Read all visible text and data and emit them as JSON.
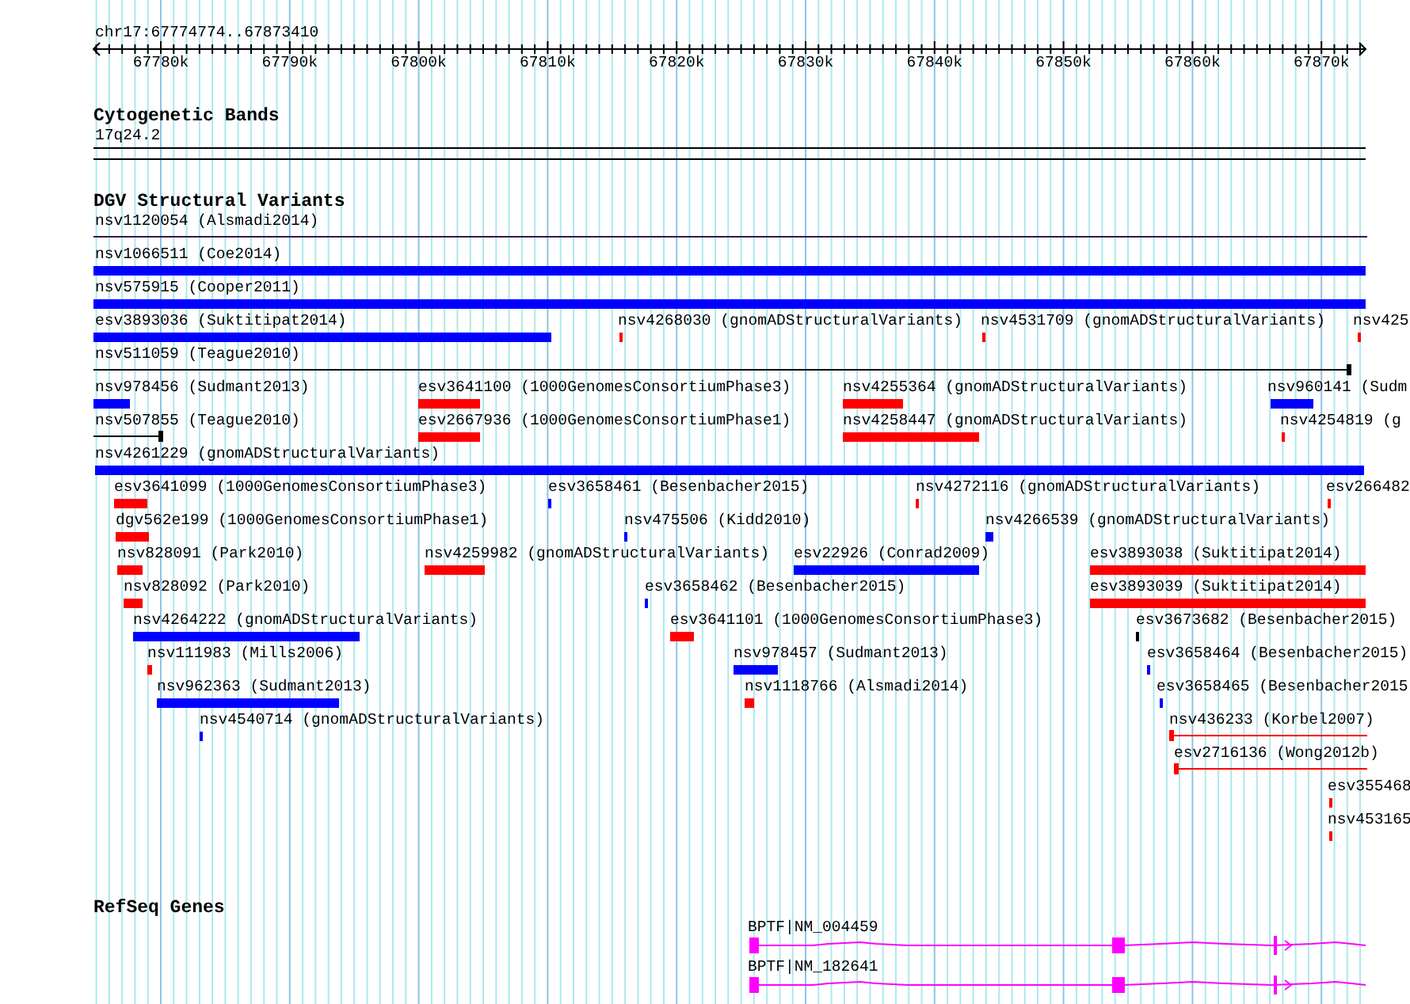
{
  "ruler": {
    "position": "chr17:67774774..67873410",
    "ticks": [
      "67780k",
      "67790k",
      "67800k",
      "67810k",
      "67820k",
      "67830k",
      "67840k",
      "67850k",
      "67860k",
      "67870k"
    ]
  },
  "cytogenetic_bands": {
    "title": "Cytogenetic Bands",
    "band": "17q24.2"
  },
  "dgv_structural_variants": {
    "title": "DGV Structural Variants",
    "variants": [
      {
        "label": "nsv1120054 (Alsmadi2014)",
        "kind": "line",
        "color": "#3c1450"
      },
      {
        "label": "nsv1066511 (Coe2014)",
        "kind": "bar",
        "color": "#0000ff"
      },
      {
        "label": "nsv575915 (Cooper2011)",
        "kind": "bar",
        "color": "#0000ff"
      },
      {
        "label": "esv3893036 (Suktitipat2014)",
        "kind": "bar",
        "color": "#0000ff"
      },
      {
        "label": "nsv4268030 (gnomADStructuralVariants)",
        "kind": "bar",
        "color": "#ff0000"
      },
      {
        "label": "nsv4531709 (gnomADStructuralVariants)",
        "kind": "bar",
        "color": "#ff0000"
      },
      {
        "label": "nsv425",
        "kind": "bar",
        "color": "#ff0000"
      },
      {
        "label": "nsv511059 (Teague2010)",
        "kind": "line",
        "color": "#000000"
      },
      {
        "label": "nsv978456 (Sudmant2013)",
        "kind": "bar",
        "color": "#0000ff"
      },
      {
        "label": "esv3641100 (1000GenomesConsortiumPhase3)",
        "kind": "bar",
        "color": "#ff0000"
      },
      {
        "label": "nsv4255364 (gnomADStructuralVariants)",
        "kind": "bar",
        "color": "#ff0000"
      },
      {
        "label": "nsv960141 (Sudm",
        "kind": "bar",
        "color": "#0000ff"
      },
      {
        "label": "nsv507855 (Teague2010)",
        "kind": "line",
        "color": "#000000"
      },
      {
        "label": "esv2667936 (1000GenomesConsortiumPhase1)",
        "kind": "bar",
        "color": "#ff0000"
      },
      {
        "label": "nsv4258447 (gnomADStructuralVariants)",
        "kind": "bar",
        "color": "#ff0000"
      },
      {
        "label": "nsv4254819 (g",
        "kind": "bar",
        "color": "#ff0000"
      },
      {
        "label": "nsv4261229 (gnomADStructuralVariants)",
        "kind": "bar",
        "color": "#0000ff"
      },
      {
        "label": "esv3641099 (1000GenomesConsortiumPhase3)",
        "kind": "bar",
        "color": "#ff0000"
      },
      {
        "label": "esv3658461 (Besenbacher2015)",
        "kind": "bar",
        "color": "#0000ff"
      },
      {
        "label": "nsv4272116 (gnomADStructuralVariants)",
        "kind": "bar",
        "color": "#ff0000"
      },
      {
        "label": "esv266482",
        "kind": "bar",
        "color": "#ff0000"
      },
      {
        "label": "dgv562e199 (1000GenomesConsortiumPhase1)",
        "kind": "bar",
        "color": "#ff0000"
      },
      {
        "label": "nsv475506 (Kidd2010)",
        "kind": "bar",
        "color": "#0000ff"
      },
      {
        "label": "nsv4266539 (gnomADStructuralVariants)",
        "kind": "bar",
        "color": "#0000ff"
      },
      {
        "label": "nsv828091 (Park2010)",
        "kind": "bar",
        "color": "#ff0000"
      },
      {
        "label": "nsv4259982 (gnomADStructuralVariants)",
        "kind": "bar",
        "color": "#ff0000"
      },
      {
        "label": "esv22926 (Conrad2009)",
        "kind": "bar",
        "color": "#0000ff"
      },
      {
        "label": "esv3893038 (Suktitipat2014)",
        "kind": "bar",
        "color": "#ff0000"
      },
      {
        "label": "nsv828092 (Park2010)",
        "kind": "bar",
        "color": "#ff0000"
      },
      {
        "label": "esv3658462 (Besenbacher2015)",
        "kind": "bar",
        "color": "#0000ff"
      },
      {
        "label": "esv3893039 (Suktitipat2014)",
        "kind": "bar",
        "color": "#ff0000"
      },
      {
        "label": "nsv4264222 (gnomADStructuralVariants)",
        "kind": "bar",
        "color": "#0000ff"
      },
      {
        "label": "esv3641101 (1000GenomesConsortiumPhase3)",
        "kind": "bar",
        "color": "#ff0000"
      },
      {
        "label": "esv3673682 (Besenbacher2015)",
        "kind": "bar",
        "color": "#000000"
      },
      {
        "label": "nsv111983 (Mills2006)",
        "kind": "bar",
        "color": "#ff0000"
      },
      {
        "label": "nsv978457 (Sudmant2013)",
        "kind": "bar",
        "color": "#0000ff"
      },
      {
        "label": "esv3658464 (Besenbacher2015)",
        "kind": "bar",
        "color": "#0000ff"
      },
      {
        "label": "nsv962363 (Sudmant2013)",
        "kind": "bar",
        "color": "#0000ff"
      },
      {
        "label": "nsv1118766 (Alsmadi2014)",
        "kind": "bar",
        "color": "#ff0000"
      },
      {
        "label": "esv3658465 (Besenbacher2015",
        "kind": "bar",
        "color": "#0000ff"
      },
      {
        "label": "nsv4540714 (gnomADStructuralVariants)",
        "kind": "bar",
        "color": "#0000ff"
      },
      {
        "label": "nsv436233 (Korbel2007)",
        "kind": "line",
        "color": "#ff0000"
      },
      {
        "label": "esv2716136 (Wong2012b)",
        "kind": "line",
        "color": "#ff0000"
      },
      {
        "label": "esv355468",
        "kind": "bar",
        "color": "#ff0000"
      },
      {
        "label": "nsv453165",
        "kind": "bar",
        "color": "#ff0000"
      }
    ]
  },
  "refseq_genes": {
    "title": "RefSeq Genes",
    "genes": [
      {
        "label": "BPTF|NM_004459"
      },
      {
        "label": "BPTF|NM_182641"
      }
    ]
  }
}
